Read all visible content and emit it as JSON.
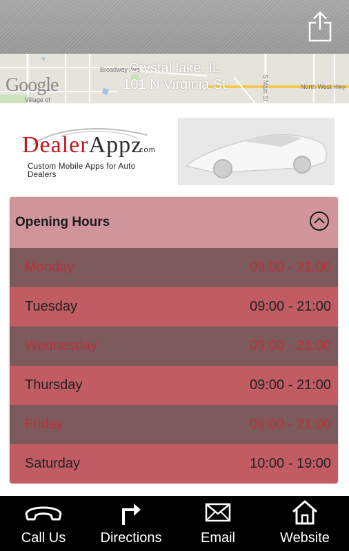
{
  "location": {
    "city": "Crystal lake, IL",
    "street": "101 N Virginia St"
  },
  "map": {
    "provider": "Google",
    "labels": [
      "Broadway Ave",
      "S Main St",
      "North West Hwy",
      "Village of"
    ]
  },
  "logo": {
    "dealer": "Dealer",
    "appz": "Appz",
    "com": ".com",
    "tagline": "Custom Mobile Apps for Auto Dealers"
  },
  "hours": {
    "title": "Opening Hours",
    "rows": [
      {
        "day": "Monday",
        "time": "09:00 - 21:00"
      },
      {
        "day": "Tuesday",
        "time": "09:00 - 21:00"
      },
      {
        "day": "Wednesday",
        "time": "09:00 - 21:00"
      },
      {
        "day": "Thursday",
        "time": "09:00 - 21:00"
      },
      {
        "day": "Friday",
        "time": "09:00 - 21:00"
      },
      {
        "day": "Saturday",
        "time": "10:00 - 19:00"
      }
    ]
  },
  "nav": {
    "call": "Call Us",
    "directions": "Directions",
    "email": "Email",
    "website": "Website"
  },
  "colors": {
    "header_gray": "#a2a2a2",
    "panel_header": "#d0959a",
    "row_dark": "#7c5a5c",
    "row_light": "#c05c62",
    "accent_red": "#b8323a",
    "nav_bg": "#000000"
  },
  "icons": {
    "share": "share-icon",
    "collapse": "chevron-up-circle-icon",
    "call": "phone-handset-icon",
    "directions": "turn-right-arrow-icon",
    "email": "envelope-icon",
    "website": "home-icon"
  }
}
